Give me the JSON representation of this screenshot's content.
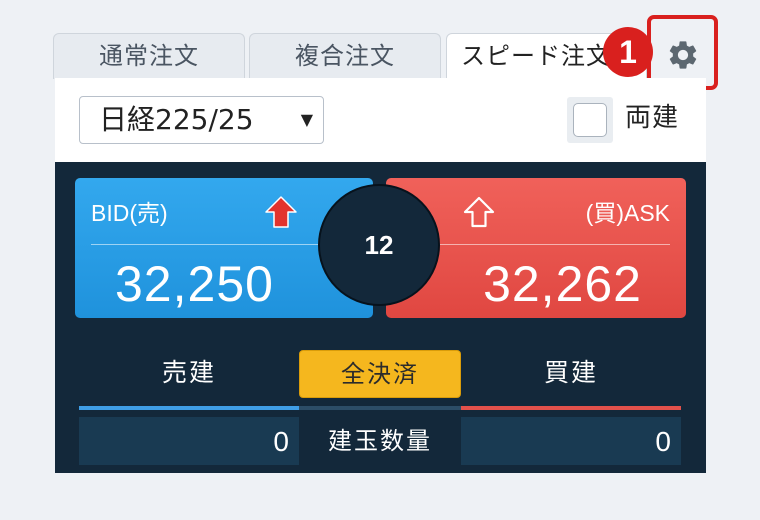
{
  "tabs": [
    {
      "label": "通常注文",
      "active": false
    },
    {
      "label": "複合注文",
      "active": false
    },
    {
      "label": "スピード注文",
      "active": true
    }
  ],
  "settings": {
    "icon": "gear-icon"
  },
  "step_badge": "1",
  "instrument": {
    "selected": "日経225/25",
    "arrow": "▼"
  },
  "hedge": {
    "label": "両建",
    "checked": false
  },
  "bid": {
    "label": "BID(売)",
    "price": "32,250",
    "arrow_icon": "arrow-up-filled-icon",
    "color": "#1f92dc"
  },
  "ask": {
    "label": "(買)ASK",
    "price": "32,262",
    "arrow_icon": "arrow-up-outline-icon",
    "color": "#e04741"
  },
  "spread": "12",
  "actions": {
    "sell": "売建",
    "close_all": "全決済",
    "buy": "買建"
  },
  "positions": {
    "label": "建玉数量",
    "sell_qty": "0",
    "buy_qty": "0"
  },
  "colors": {
    "accent_red": "#d9201e",
    "button_yellow": "#f5b71e",
    "dark_bg": "#13283a"
  }
}
